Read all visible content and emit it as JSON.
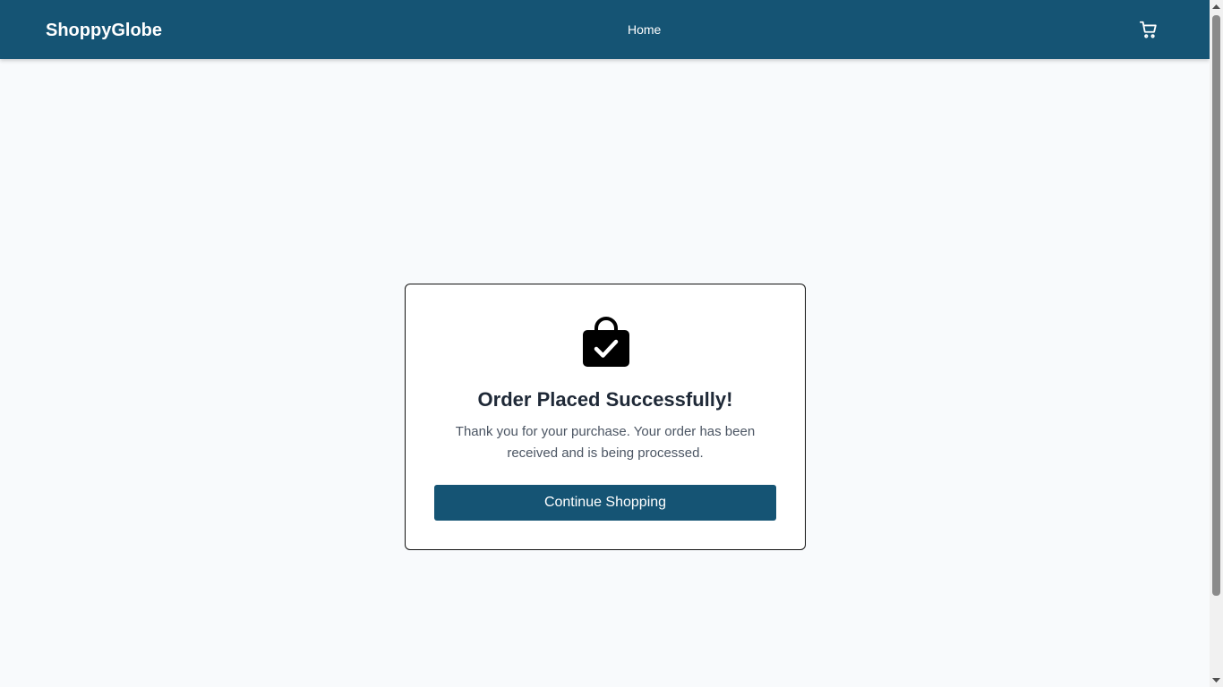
{
  "header": {
    "brand": "ShoppyGlobe",
    "nav": {
      "home_label": "Home"
    },
    "cart_icon": "shopping-cart-icon",
    "background_color": "#155474"
  },
  "confirmation": {
    "icon": "shopping-bag-check-icon",
    "title": "Order Placed Successfully!",
    "message": "Thank you for your purchase. Your order has been received and is being processed.",
    "button_label": "Continue Shopping",
    "button_color": "#155474"
  }
}
